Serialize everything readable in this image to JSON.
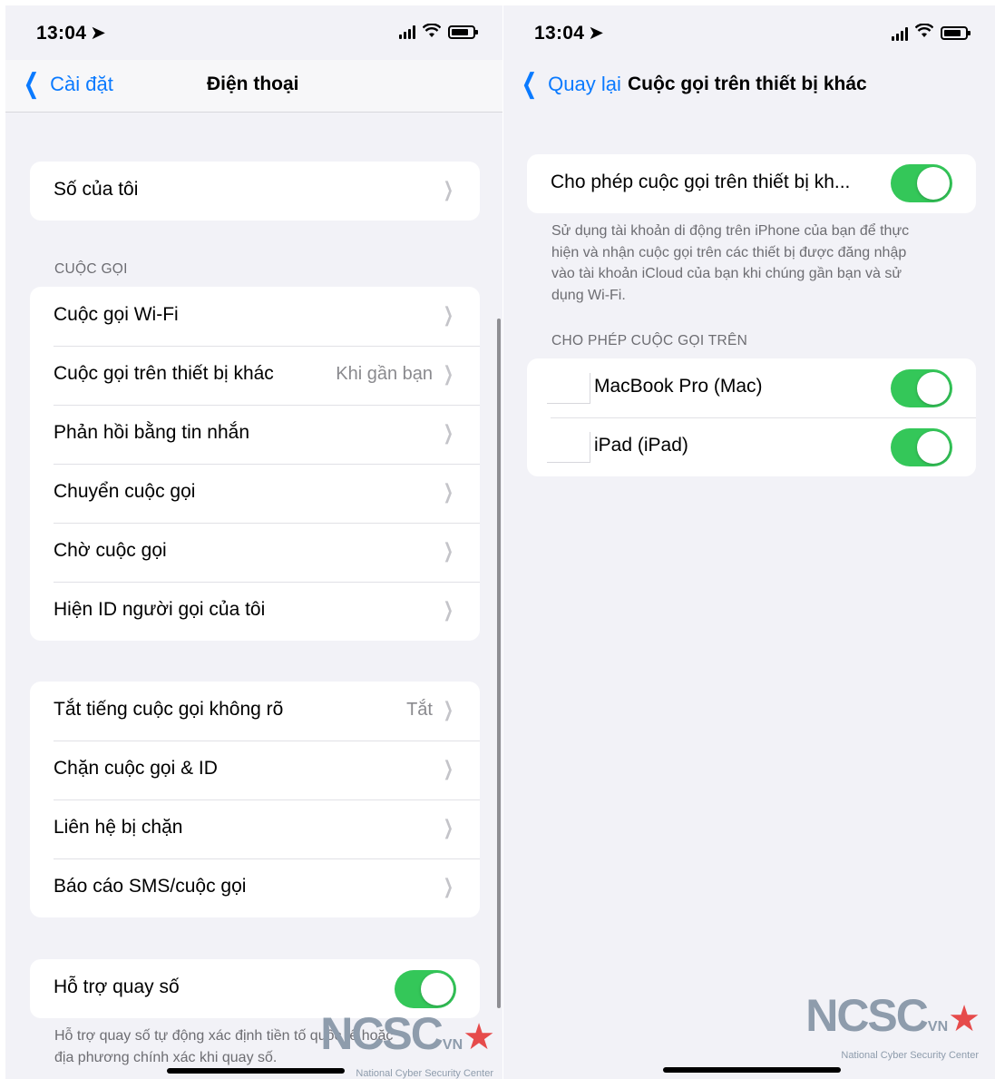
{
  "left": {
    "status": {
      "time": "13:04"
    },
    "nav": {
      "back_label": "Cài đặt",
      "title": "Điện thoại"
    },
    "my_number": {
      "label": "Số của tôi"
    },
    "calls_header": "CUỘC GỌI",
    "calls": [
      {
        "label": "Cuộc gọi Wi-Fi",
        "value": ""
      },
      {
        "label": "Cuộc gọi trên thiết bị khác",
        "value": "Khi gần bạn"
      },
      {
        "label": "Phản hồi bằng tin nhắn",
        "value": ""
      },
      {
        "label": "Chuyển cuộc gọi",
        "value": ""
      },
      {
        "label": "Chờ cuộc gọi",
        "value": ""
      },
      {
        "label": "Hiện ID người gọi của tôi",
        "value": ""
      }
    ],
    "blocking": [
      {
        "label": "Tắt tiếng cuộc gọi không rõ",
        "value": "Tắt"
      },
      {
        "label": "Chặn cuộc gọi & ID",
        "value": ""
      },
      {
        "label": "Liên hệ bị chặn",
        "value": ""
      },
      {
        "label": "Báo cáo SMS/cuộc gọi",
        "value": ""
      }
    ],
    "dial_assist": {
      "label": "Hỗ trợ quay số",
      "on": true
    },
    "dial_assist_footer_line1": "Hỗ trợ quay số tự động xác định tiền tố quốc tế hoặc",
    "dial_assist_footer_line2": "địa phương chính xác khi quay số."
  },
  "right": {
    "status": {
      "time": "13:04"
    },
    "nav": {
      "back_label": "Quay lại",
      "title": "Cuộc gọi trên thiết bị khác"
    },
    "allow_toggle": {
      "label": "Cho phép cuộc gọi trên thiết bị kh...",
      "on": true
    },
    "footer_line1": "Sử dụng tài khoản di động trên iPhone của bạn để thực",
    "footer_line2": "hiện và nhận cuộc gọi trên các thiết bị được đăng nhập",
    "footer_line3": "vào tài khoản iCloud của bạn khi chúng gần bạn và sử",
    "footer_line4": "dụng Wi-Fi.",
    "devices_header": "CHO PHÉP CUỘC GỌI TRÊN",
    "devices": [
      {
        "label": "MacBook Pro (Mac)",
        "on": true
      },
      {
        "label": "iPad (iPad)",
        "on": true
      }
    ]
  },
  "watermark": {
    "logo": "NCSC",
    "logo_suffix": "VN",
    "subtitle": "National Cyber Security Center"
  },
  "colors": {
    "accent": "#0a7aff",
    "toggle_on": "#34c759",
    "background": "#f2f2f7"
  }
}
